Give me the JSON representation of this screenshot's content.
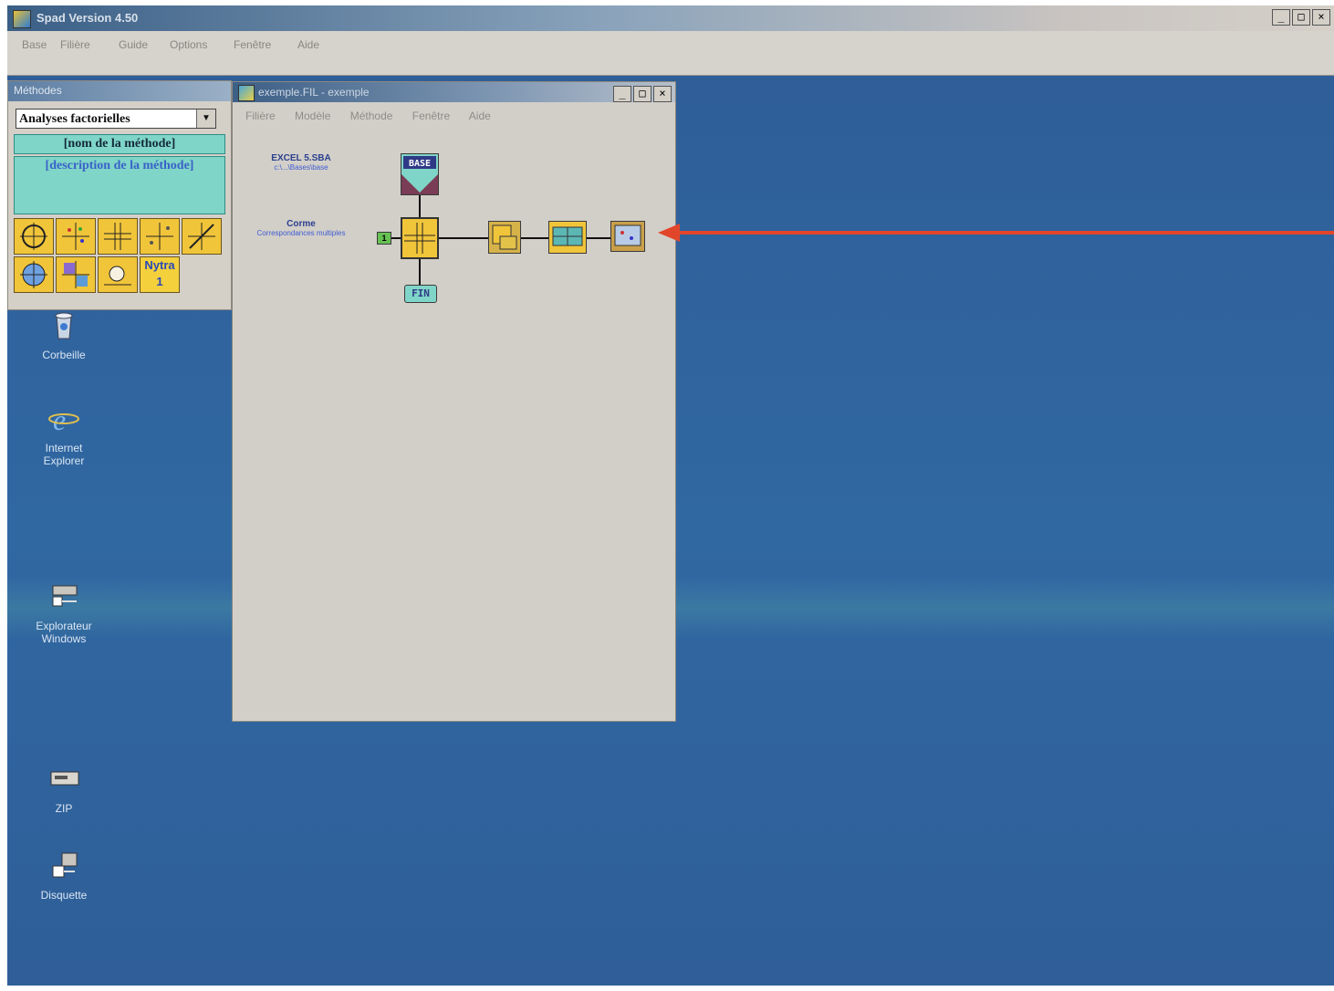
{
  "app": {
    "title": "Spad Version 4.50",
    "window_controls": [
      "_",
      "□",
      "×"
    ],
    "menu": [
      "Base",
      "Filière",
      "Guide",
      "Options",
      "Fenêtre",
      "Aide"
    ]
  },
  "palette": {
    "title": "Méthodes",
    "category_select": "Analyses factorielles",
    "method_name": "[nom de la méthode]",
    "method_description": "[description de la méthode]",
    "tool_label": "Nytra 1"
  },
  "diagram": {
    "title": "exemple.FIL - exemple",
    "window_controls": [
      "_",
      "□",
      "×"
    ],
    "menu": [
      "Filière",
      "Modèle",
      "Méthode",
      "Fenêtre",
      "Aide"
    ],
    "base_label": "EXCEL 5.SBA",
    "base_sublabel": "c:\\...\\Bases\\base",
    "method_label": "Corme",
    "method_sublabel": "Correspondances multiples",
    "node_base": "BASE",
    "node_end": "FIN",
    "step_number": "1"
  },
  "desktop_icons": [
    {
      "name": "Corbeille",
      "icon": "recycle-bin-icon"
    },
    {
      "name": "Internet Explorer",
      "icon": "internet-explorer-icon"
    },
    {
      "name": "Explorateur Windows",
      "icon": "windows-explorer-icon"
    },
    {
      "name": "ZIP",
      "icon": "zip-drive-icon"
    },
    {
      "name": "Disquette",
      "icon": "floppy-disk-icon"
    }
  ],
  "colors": {
    "desktop": "#2f5f97",
    "arrow": "#e2462a",
    "node_yellow": "#f1c53a",
    "node_teal": "#7fd5c8"
  }
}
